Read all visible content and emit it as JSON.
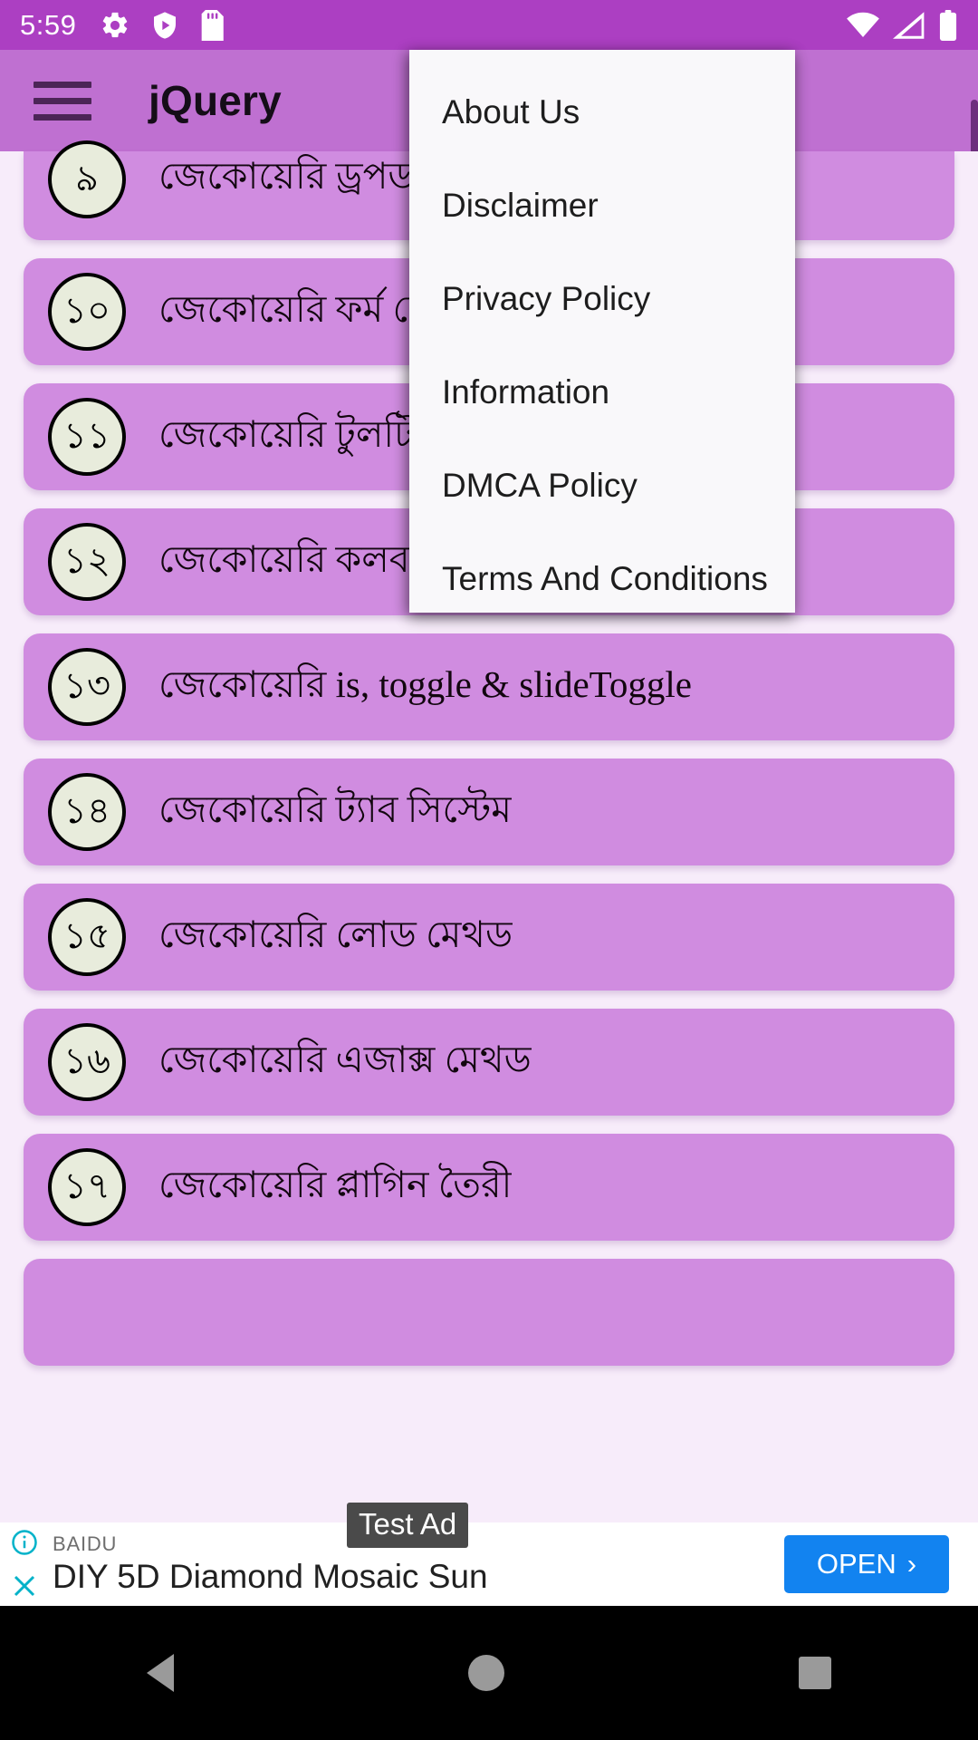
{
  "status_bar": {
    "time": "5:59",
    "icons_left": [
      "gear-icon",
      "shield-play-icon",
      "sd-card-icon"
    ],
    "icons_right": [
      "wifi-icon",
      "cellular-signal-icon",
      "battery-icon"
    ],
    "background_color": "#ac3fc2"
  },
  "app_bar": {
    "title": "jQuery",
    "menu_icon": "hamburger-menu-icon",
    "background_color": "#bf70d1"
  },
  "overflow_menu": {
    "items": [
      {
        "label": "About Us"
      },
      {
        "label": "Disclaimer"
      },
      {
        "label": "Privacy Policy"
      },
      {
        "label": "Information"
      },
      {
        "label": "DMCA Policy"
      },
      {
        "label": "Terms And Conditions"
      }
    ],
    "background_color": "#f9f8fa"
  },
  "list": {
    "card_color": "#d08ce0",
    "background_color": "#f7ecfa",
    "items": [
      {
        "number": "৯",
        "label": "জেকোয়েরি ড্রপডাউন মেনু"
      },
      {
        "number": "১০",
        "label": "জেকোয়েরি ফর্ম ভেলিডেশন"
      },
      {
        "number": "১১",
        "label": "জেকোয়েরি টুলটিপ ডিজাইন"
      },
      {
        "number": "১২",
        "label": "জেকোয়েরি কলব্যাক ফাংশন"
      },
      {
        "number": "১৩",
        "label": "জেকোয়েরি is, toggle & slideToggle"
      },
      {
        "number": "১৪",
        "label": "জেকোয়েরি ট্যাব সিস্টেম"
      },
      {
        "number": "১৫",
        "label": "জেকোয়েরি লোড মেথড"
      },
      {
        "number": "১৬",
        "label": "জেকোয়েরি এজাক্স মেথড"
      },
      {
        "number": "১৭",
        "label": "জেকোয়েরি প্লাগিন তৈরী"
      }
    ]
  },
  "ad": {
    "advertiser": "BAIDU",
    "headline": "DIY 5D Diamond Mosaic Sun",
    "badge": "Test Ad",
    "cta_label": "OPEN",
    "cta_chevron": "›",
    "cta_color": "#1283f0",
    "info_icon": "ad-info-icon",
    "close_icon": "ad-close-icon"
  },
  "nav_bar": {
    "back": "back-triangle-icon",
    "home": "home-circle-icon",
    "recents": "recents-square-icon"
  }
}
